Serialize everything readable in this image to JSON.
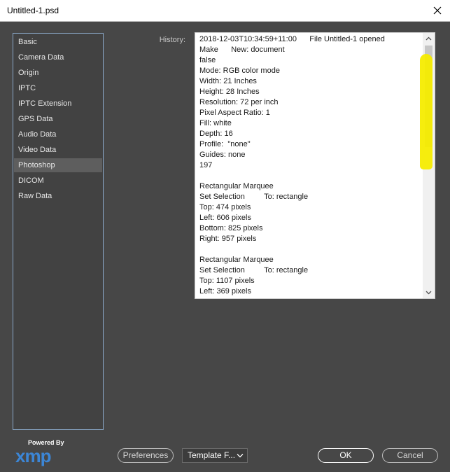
{
  "window": {
    "title": "Untitled-1.psd",
    "close_glyph": "✕"
  },
  "sidebar": {
    "items": [
      {
        "label": "Basic"
      },
      {
        "label": "Camera Data"
      },
      {
        "label": "Origin"
      },
      {
        "label": "IPTC"
      },
      {
        "label": "IPTC Extension"
      },
      {
        "label": "GPS Data"
      },
      {
        "label": "Audio Data"
      },
      {
        "label": "Video Data"
      },
      {
        "label": "Photoshop",
        "selected": true
      },
      {
        "label": "DICOM"
      },
      {
        "label": "Raw Data"
      }
    ]
  },
  "history": {
    "label": "History:",
    "text": "2018-12-03T10:34:59+11:00      File Untitled-1 opened\nMake      New: document\nfalse\nMode: RGB color mode\nWidth: 21 Inches\nHeight: 28 Inches\nResolution: 72 per inch\nPixel Aspect Ratio: 1\nFill: white\nDepth: 16\nProfile:  \"none\"\nGuides: none\n197\n\nRectangular Marquee\nSet Selection         To: rectangle\nTop: 474 pixels\nLeft: 606 pixels\nBottom: 825 pixels\nRight: 957 pixels\n\nRectangular Marquee\nSet Selection         To: rectangle\nTop: 1107 pixels\nLeft: 369 pixels"
  },
  "footer": {
    "powered_by": "Powered By",
    "logo_text": "xmp",
    "preferences_label": "Preferences",
    "template_label": "Template F...",
    "ok_label": "OK",
    "cancel_label": "Cancel"
  },
  "colors": {
    "background": "#474747",
    "highlight": "#f5ec00",
    "xmp_blue": "#3c86d6",
    "sidebar_border": "#8aa8c8"
  }
}
